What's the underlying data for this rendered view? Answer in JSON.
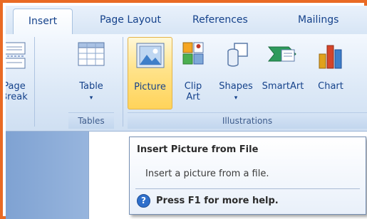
{
  "tabs": {
    "insert": "Insert",
    "page_layout": "Page Layout",
    "references": "References",
    "mailings": "Mailings"
  },
  "buttons": {
    "page_break": "Page\nBreak",
    "table": "Table",
    "picture": "Picture",
    "clip_art": "Clip\nArt",
    "shapes": "Shapes",
    "smartart": "SmartArt",
    "chart": "Chart"
  },
  "groups": {
    "tables": "Tables",
    "illustrations": "Illustrations"
  },
  "tooltip": {
    "title": "Insert Picture from File",
    "body": "Insert a picture from a file.",
    "help": "Press F1 for more help.",
    "help_glyph": "?"
  },
  "colors": {
    "frame": "#e96a24",
    "accent_text": "#15428b",
    "hover": "#ffd35a"
  }
}
